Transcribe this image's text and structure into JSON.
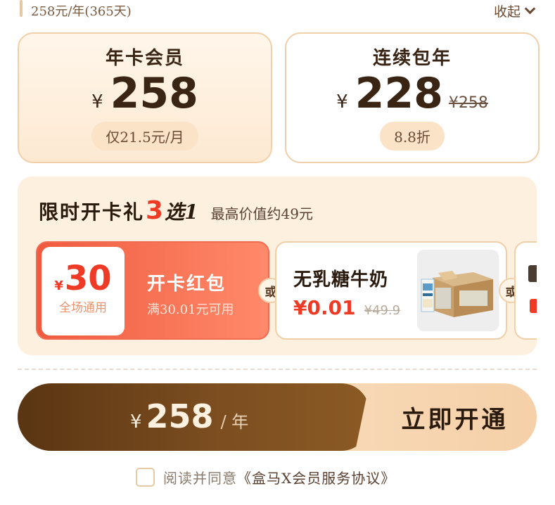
{
  "header": {
    "summary": "258元/年(365天)",
    "collapse_label": "收起"
  },
  "plans": [
    {
      "title": "年卡会员",
      "currency": "¥",
      "price": "258",
      "note": "仅21.5元/月",
      "selected": true
    },
    {
      "title": "连续包年",
      "currency": "¥",
      "price": "228",
      "original_price": "¥258",
      "note": "8.8折",
      "selected": false
    }
  ],
  "gift": {
    "heading_main": "限时开卡礼",
    "heading_count": "3",
    "heading_pick": "选1",
    "heading_sub": "最高价值约49元",
    "or_label": "或",
    "options": {
      "coupon": {
        "currency": "¥",
        "amount": "30",
        "scope": "全场通用",
        "title": "开卡红包",
        "condition": "满30.01元可用"
      },
      "milk": {
        "title": "无乳糖牛奶",
        "price": "¥0.01",
        "original_price": "¥49.9",
        "image": "milk-box-image"
      }
    }
  },
  "cta": {
    "currency": "¥",
    "price": "258",
    "period": "/ 年",
    "action_label": "立即开通"
  },
  "agreement": {
    "checked": false,
    "prefix": "阅读并同意",
    "link_text": "《盒马X会员服务协议》"
  },
  "colors": {
    "accent_red": "#ef3b26",
    "brown_dark": "#5a3512",
    "card_border": "#f1cfa8",
    "cream": "#fdf0df"
  }
}
